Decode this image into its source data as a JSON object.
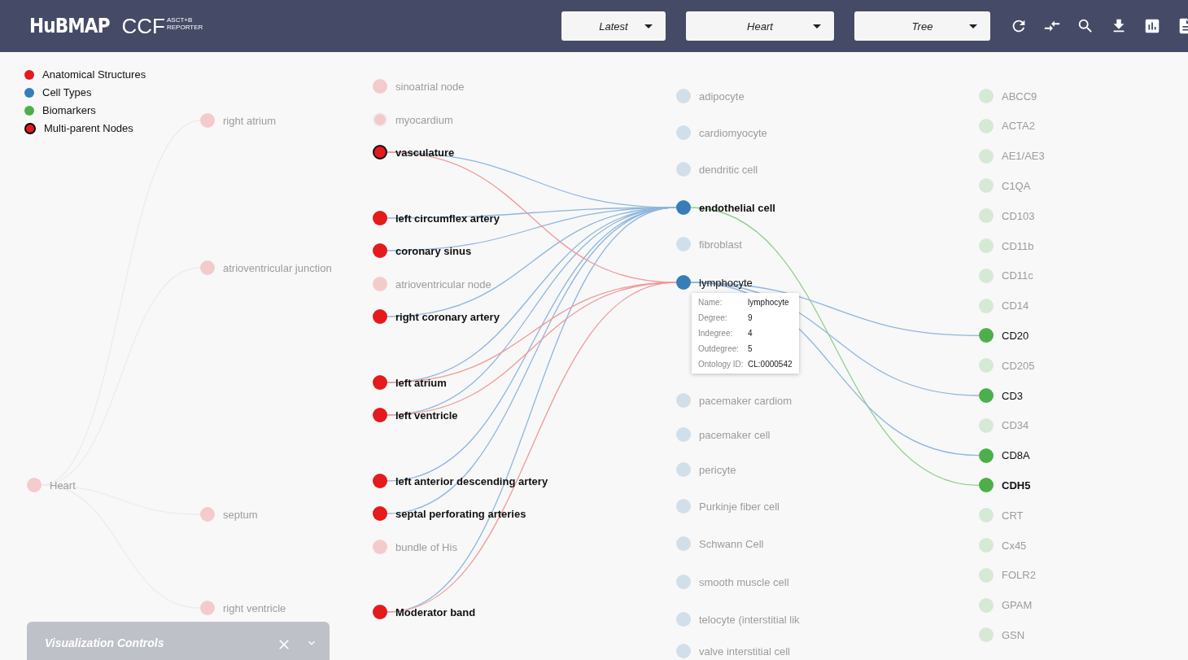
{
  "header": {
    "brand": "HuBMAP",
    "product": "CCF",
    "sup_top": "ASCT+B",
    "sup_bottom": "REPORTER",
    "dropdowns": [
      {
        "value": "Latest"
      },
      {
        "value": "Heart"
      },
      {
        "value": "Tree"
      }
    ]
  },
  "legend": [
    {
      "label": "Anatomical Structures",
      "kind": "plain",
      "color": "#e41a1c"
    },
    {
      "label": "Cell Types",
      "kind": "plain",
      "color": "#377eb8"
    },
    {
      "label": "Biomarkers",
      "kind": "plain",
      "color": "#4daf4a"
    },
    {
      "label": "Multi-parent Nodes",
      "kind": "outlined",
      "color": "#e41a1c"
    }
  ],
  "graph": {
    "columns": [
      {
        "kind": "anatomical",
        "nodes": [
          {
            "label": "Heart",
            "highlighted": false,
            "multi_parent": false,
            "bold": false
          }
        ]
      },
      {
        "kind": "anatomical",
        "nodes": [
          {
            "label": "right atrium",
            "highlighted": false,
            "multi_parent": false,
            "bold": false
          },
          {
            "label": "atrioventricular junction",
            "highlighted": false,
            "multi_parent": false,
            "bold": false
          },
          {
            "label": "septum",
            "highlighted": false,
            "multi_parent": false,
            "bold": false
          },
          {
            "label": "right ventricle",
            "highlighted": false,
            "multi_parent": false,
            "bold": false
          }
        ]
      },
      {
        "kind": "anatomical",
        "nodes": [
          {
            "label": "sinoatrial node",
            "highlighted": false,
            "multi_parent": false,
            "bold": false
          },
          {
            "label": "myocardium",
            "highlighted": false,
            "multi_parent": true,
            "bold": false
          },
          {
            "label": "vasculature",
            "highlighted": true,
            "multi_parent": true,
            "bold": true
          },
          {
            "label": "left circumflex artery",
            "highlighted": true,
            "multi_parent": false,
            "bold": true
          },
          {
            "label": "coronary sinus",
            "highlighted": true,
            "multi_parent": false,
            "bold": true
          },
          {
            "label": "atrioventricular node",
            "highlighted": false,
            "multi_parent": false,
            "bold": false
          },
          {
            "label": "right coronary artery",
            "highlighted": true,
            "multi_parent": false,
            "bold": true
          },
          {
            "label": "left atrium",
            "highlighted": true,
            "multi_parent": false,
            "bold": true
          },
          {
            "label": "left ventricle",
            "highlighted": true,
            "multi_parent": false,
            "bold": true
          },
          {
            "label": "left anterior descending artery",
            "highlighted": true,
            "multi_parent": false,
            "bold": true
          },
          {
            "label": "septal perforating arteries",
            "highlighted": true,
            "multi_parent": false,
            "bold": true
          },
          {
            "label": "bundle of His",
            "highlighted": false,
            "multi_parent": false,
            "bold": false
          },
          {
            "label": "Moderator band",
            "highlighted": true,
            "multi_parent": false,
            "bold": true
          }
        ]
      },
      {
        "kind": "cell",
        "nodes": [
          {
            "label": "adipocyte",
            "highlighted": false,
            "multi_parent": false,
            "bold": false
          },
          {
            "label": "cardiomyocyte",
            "highlighted": false,
            "multi_parent": false,
            "bold": false
          },
          {
            "label": "dendritic cell",
            "highlighted": false,
            "multi_parent": false,
            "bold": false
          },
          {
            "label": "endothelial cell",
            "highlighted": true,
            "multi_parent": false,
            "bold": true
          },
          {
            "label": "fibroblast",
            "highlighted": false,
            "multi_parent": false,
            "bold": false
          },
          {
            "label": "lymphocyte",
            "highlighted": true,
            "multi_parent": false,
            "bold": false
          },
          {
            "label": "pacemaker cardiom",
            "highlighted": false,
            "multi_parent": false,
            "bold": false
          },
          {
            "label": "pacemaker cell",
            "highlighted": false,
            "multi_parent": false,
            "bold": false
          },
          {
            "label": "pericyte",
            "highlighted": false,
            "multi_parent": false,
            "bold": false
          },
          {
            "label": "Purkinje fiber cell",
            "highlighted": false,
            "multi_parent": false,
            "bold": false
          },
          {
            "label": "Schwann Cell",
            "highlighted": false,
            "multi_parent": false,
            "bold": false
          },
          {
            "label": "smooth muscle cell",
            "highlighted": false,
            "multi_parent": false,
            "bold": false
          },
          {
            "label": "telocyte (interstitial lik",
            "highlighted": false,
            "multi_parent": false,
            "bold": false
          },
          {
            "label": "valve interstitial cell",
            "highlighted": false,
            "multi_parent": false,
            "bold": false
          }
        ]
      },
      {
        "kind": "biomarker",
        "nodes": [
          {
            "label": "ABCC9",
            "highlighted": false,
            "multi_parent": false,
            "bold": false
          },
          {
            "label": "ACTA2",
            "highlighted": false,
            "multi_parent": false,
            "bold": false
          },
          {
            "label": "AE1/AE3",
            "highlighted": false,
            "multi_parent": false,
            "bold": false
          },
          {
            "label": "C1QA",
            "highlighted": false,
            "multi_parent": false,
            "bold": false
          },
          {
            "label": "CD103",
            "highlighted": false,
            "multi_parent": false,
            "bold": false
          },
          {
            "label": "CD11b",
            "highlighted": false,
            "multi_parent": false,
            "bold": false
          },
          {
            "label": "CD11c",
            "highlighted": false,
            "multi_parent": false,
            "bold": false
          },
          {
            "label": "CD14",
            "highlighted": false,
            "multi_parent": false,
            "bold": false
          },
          {
            "label": "CD20",
            "highlighted": true,
            "multi_parent": false,
            "bold": false
          },
          {
            "label": "CD205",
            "highlighted": false,
            "multi_parent": false,
            "bold": false
          },
          {
            "label": "CD3",
            "highlighted": true,
            "multi_parent": false,
            "bold": false
          },
          {
            "label": "CD34",
            "highlighted": false,
            "multi_parent": false,
            "bold": false
          },
          {
            "label": "CD8A",
            "highlighted": true,
            "multi_parent": false,
            "bold": false
          },
          {
            "label": "CDH5",
            "highlighted": true,
            "multi_parent": false,
            "bold": true
          },
          {
            "label": "CRT",
            "highlighted": false,
            "multi_parent": false,
            "bold": false
          },
          {
            "label": "Cx45",
            "highlighted": false,
            "multi_parent": false,
            "bold": false
          },
          {
            "label": "FOLR2",
            "highlighted": false,
            "multi_parent": false,
            "bold": false
          },
          {
            "label": "GPAM",
            "highlighted": false,
            "multi_parent": false,
            "bold": false
          },
          {
            "label": "GSN",
            "highlighted": false,
            "multi_parent": false,
            "bold": false
          }
        ]
      }
    ]
  },
  "tooltip": {
    "rows": [
      {
        "key": "Name:",
        "value": "lymphocyte"
      },
      {
        "key": "Degree:",
        "value": "9"
      },
      {
        "key": "Indegree:",
        "value": "4"
      },
      {
        "key": "Outdegree:",
        "value": "5"
      },
      {
        "key": "Ontology ID:",
        "value": "CL:0000542"
      }
    ]
  },
  "controls_panel": {
    "title": "Visualization Controls"
  }
}
